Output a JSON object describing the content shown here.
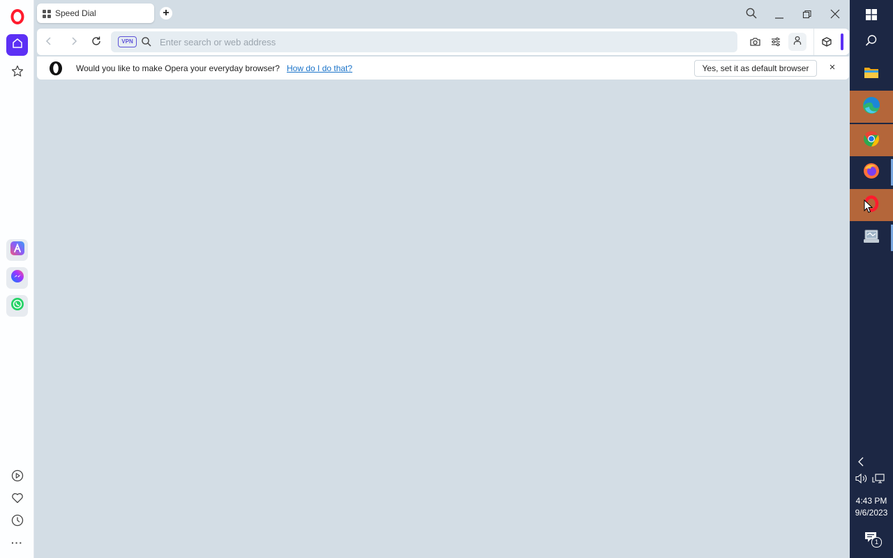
{
  "browser": {
    "tab": {
      "title": "Speed Dial"
    },
    "address_bar": {
      "placeholder": "Enter search or web address",
      "vpn_label": "VPN"
    },
    "notification": {
      "message": "Would you like to make Opera your everyday browser?",
      "link": "How do I do that?",
      "button": "Yes, set it as default browser",
      "close": "×"
    }
  },
  "sidebar": {
    "items": [
      "home",
      "bookmarks",
      "aria",
      "messenger",
      "whatsapp",
      "player",
      "my-flow",
      "history",
      "more"
    ],
    "more_label": "···"
  },
  "taskbar": {
    "apps": [
      "file-explorer",
      "edge",
      "chrome",
      "firefox",
      "opera",
      "control-panel"
    ],
    "time": "4:43 PM",
    "date": "9/6/2023",
    "notification_count": "1"
  },
  "colors": {
    "accent": "#5c30f5",
    "opera_red": "#ff1b2d",
    "taskbar": "#1c2744",
    "taskbar_active": "#b4663a",
    "background": "#d3dde5"
  }
}
